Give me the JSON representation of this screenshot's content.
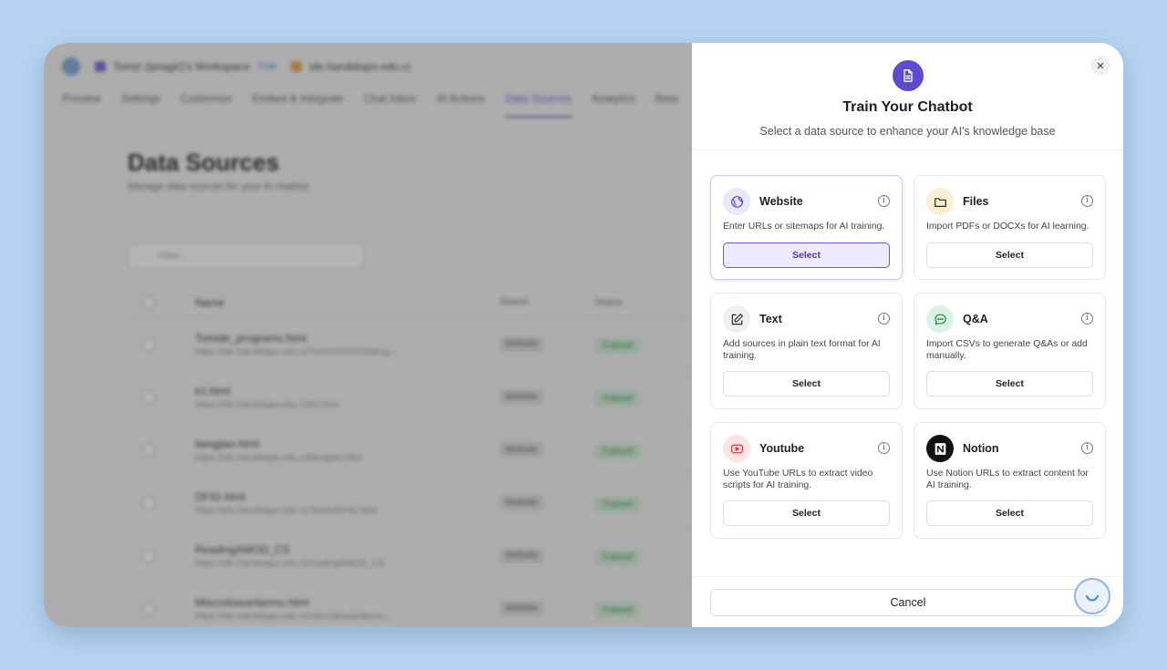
{
  "background_app": {
    "workspace_name": "Tomić (Ipragić)'s Workspace",
    "workspace_badge": "Trial",
    "site_name": "ide.harukitapo.edu.ci",
    "tabs": [
      "Preview",
      "Settings",
      "Customize",
      "Embed & Integrate",
      "Chat Inbox",
      "AI Actions",
      "Data Sources",
      "Analytics",
      "Beta"
    ],
    "page_title": "Data Sources",
    "page_subtitle": "Manage data sources for your AI chatbot",
    "filter_placeholder": "Filter...",
    "table_headers": [
      "Name",
      "Source",
      "Status"
    ],
    "rows": [
      {
        "name": "Tomide_programs.html",
        "url": "https://ide.harukitapo.edu.ci/Tomic/OOSOS/prog...",
        "source": "Website",
        "status": "Trained"
      },
      {
        "name": "k1.html",
        "url": "https://ide.harukitapo.edu.ci/k1.html",
        "source": "Website",
        "status": "Trained"
      },
      {
        "name": "liangjiao.html",
        "url": "https://ide.harukitapo.edu.ci/liangjiao.html",
        "source": "Website",
        "status": "Trained"
      },
      {
        "name": "DFIG.html",
        "url": "https://ide.harukitapo.edu.ci/Tomic/DFIG.html",
        "source": "Website",
        "status": "Trained"
      },
      {
        "name": "ReadingAMOD_CS",
        "url": "https://ide.harukitapo.edu.ci/readingAMOD_CS",
        "source": "Website",
        "status": "Trained"
      },
      {
        "name": "Miscrobasartamnu.html",
        "url": "https://ide.harukitapo.edu.ci/miscrobasartamnu...",
        "source": "Website",
        "status": "Trained"
      }
    ]
  },
  "panel": {
    "title": "Train Your Chatbot",
    "subtitle": "Select a data source to enhance your AI's knowledge base",
    "cancel_label": "Cancel",
    "info_glyph": "i",
    "sources": [
      {
        "key": "website",
        "title": "Website",
        "desc": "Enter URLs or sitemaps for AI training.",
        "button": "Select",
        "icon": "globe-icon",
        "icon_bg": "#ece8fb",
        "icon_color": "#5b4bd1"
      },
      {
        "key": "files",
        "title": "Files",
        "desc": "Import PDFs or DOCXs for AI learning.",
        "button": "Select",
        "icon": "folder-icon",
        "icon_bg": "#fbefd2",
        "icon_color": "#2a2a2a"
      },
      {
        "key": "text",
        "title": "Text",
        "desc": "Add sources in plain text format for AI training.",
        "button": "Select",
        "icon": "pencil-icon",
        "icon_bg": "#f0f0f2",
        "icon_color": "#2a2a2a"
      },
      {
        "key": "qa",
        "title": "Q&A",
        "desc": "Import CSVs to generate Q&As or add manually.",
        "button": "Select",
        "icon": "chat-bubble-icon",
        "icon_bg": "#d9f3e2",
        "icon_color": "#2d8a4e"
      },
      {
        "key": "youtube",
        "title": "Youtube",
        "desc": "Use YouTube URLs to extract video scripts for AI training.",
        "button": "Select",
        "icon": "youtube-icon",
        "icon_bg": "#fde3e3",
        "icon_color": "#d43a3a"
      },
      {
        "key": "notion",
        "title": "Notion",
        "desc": "Use Notion URLs to extract content for AI training.",
        "button": "Select",
        "icon": "notion-icon",
        "icon_bg": "#111111",
        "icon_color": "#ffffff"
      }
    ]
  },
  "colors": {
    "accent": "#5b4bd1",
    "page_bg": "#b6d4f3"
  }
}
